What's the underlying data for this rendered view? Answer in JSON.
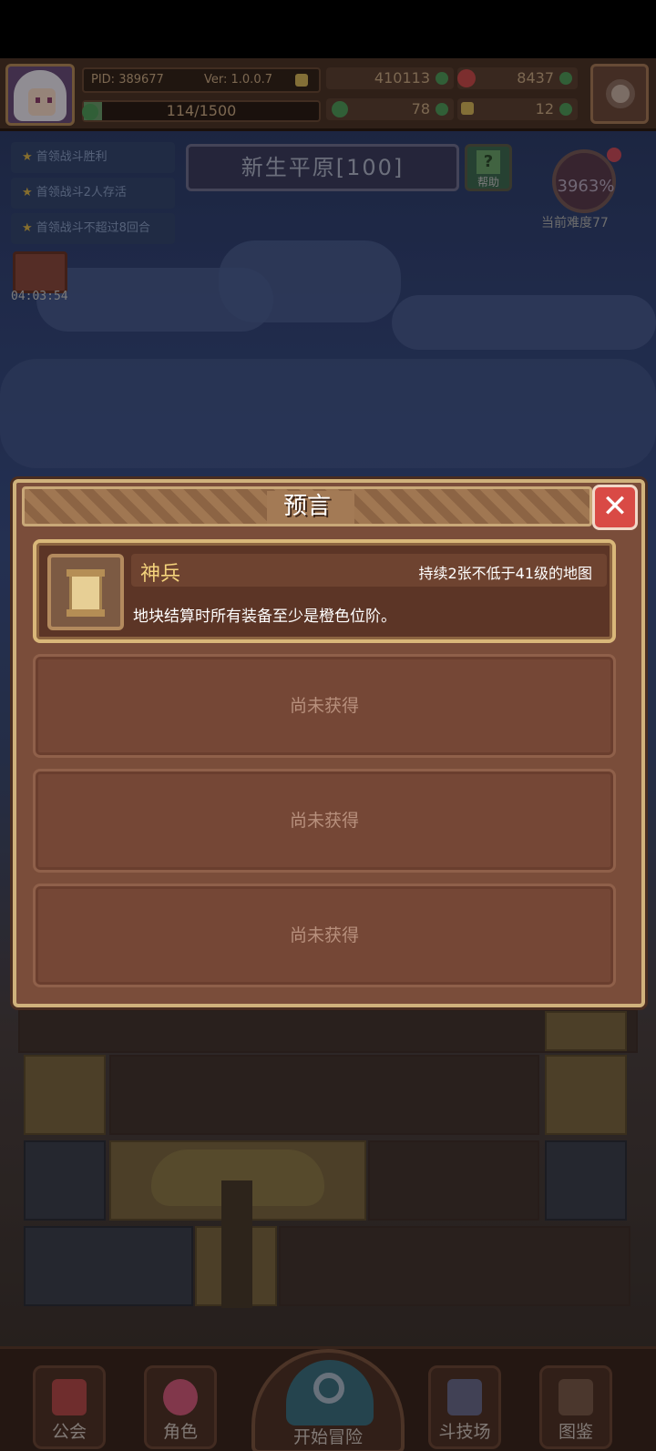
{
  "player": {
    "pid": "PID: 389677",
    "version": "Ver: 1.0.0.7",
    "exp": "114/1500",
    "exp_fraction": 0.076
  },
  "currencies": {
    "coins": "410113",
    "gems": "8437",
    "clovers": "78",
    "keys": "12"
  },
  "quests": [
    {
      "label": "首领战斗胜利"
    },
    {
      "label": "首领战斗2人存活"
    },
    {
      "label": "首领战斗不超过8回合"
    }
  ],
  "chest_timer": "04:03:54",
  "map": {
    "name": "新生平原[100]",
    "help_label": "帮助"
  },
  "difficulty": {
    "percent": "3963%",
    "label": "当前难度77"
  },
  "modal": {
    "title": "预言",
    "close_symbol": "✕",
    "cards": [
      {
        "name": "神兵",
        "condition": "持续2张不低于41级的地图",
        "description": "地块结算时所有装备至少是橙色位阶。",
        "icon": "scroll-icon"
      },
      {
        "locked_text": "尚未获得"
      },
      {
        "locked_text": "尚未获得"
      },
      {
        "locked_text": "尚未获得"
      }
    ]
  },
  "bottom_nav": [
    {
      "label": "公会",
      "icon": "guild-icon"
    },
    {
      "label": "角色",
      "icon": "character-icon"
    },
    {
      "label": "开始冒险",
      "icon": "adventure-icon"
    },
    {
      "label": "斗技场",
      "icon": "arena-icon"
    },
    {
      "label": "图鉴",
      "icon": "codex-icon"
    }
  ]
}
